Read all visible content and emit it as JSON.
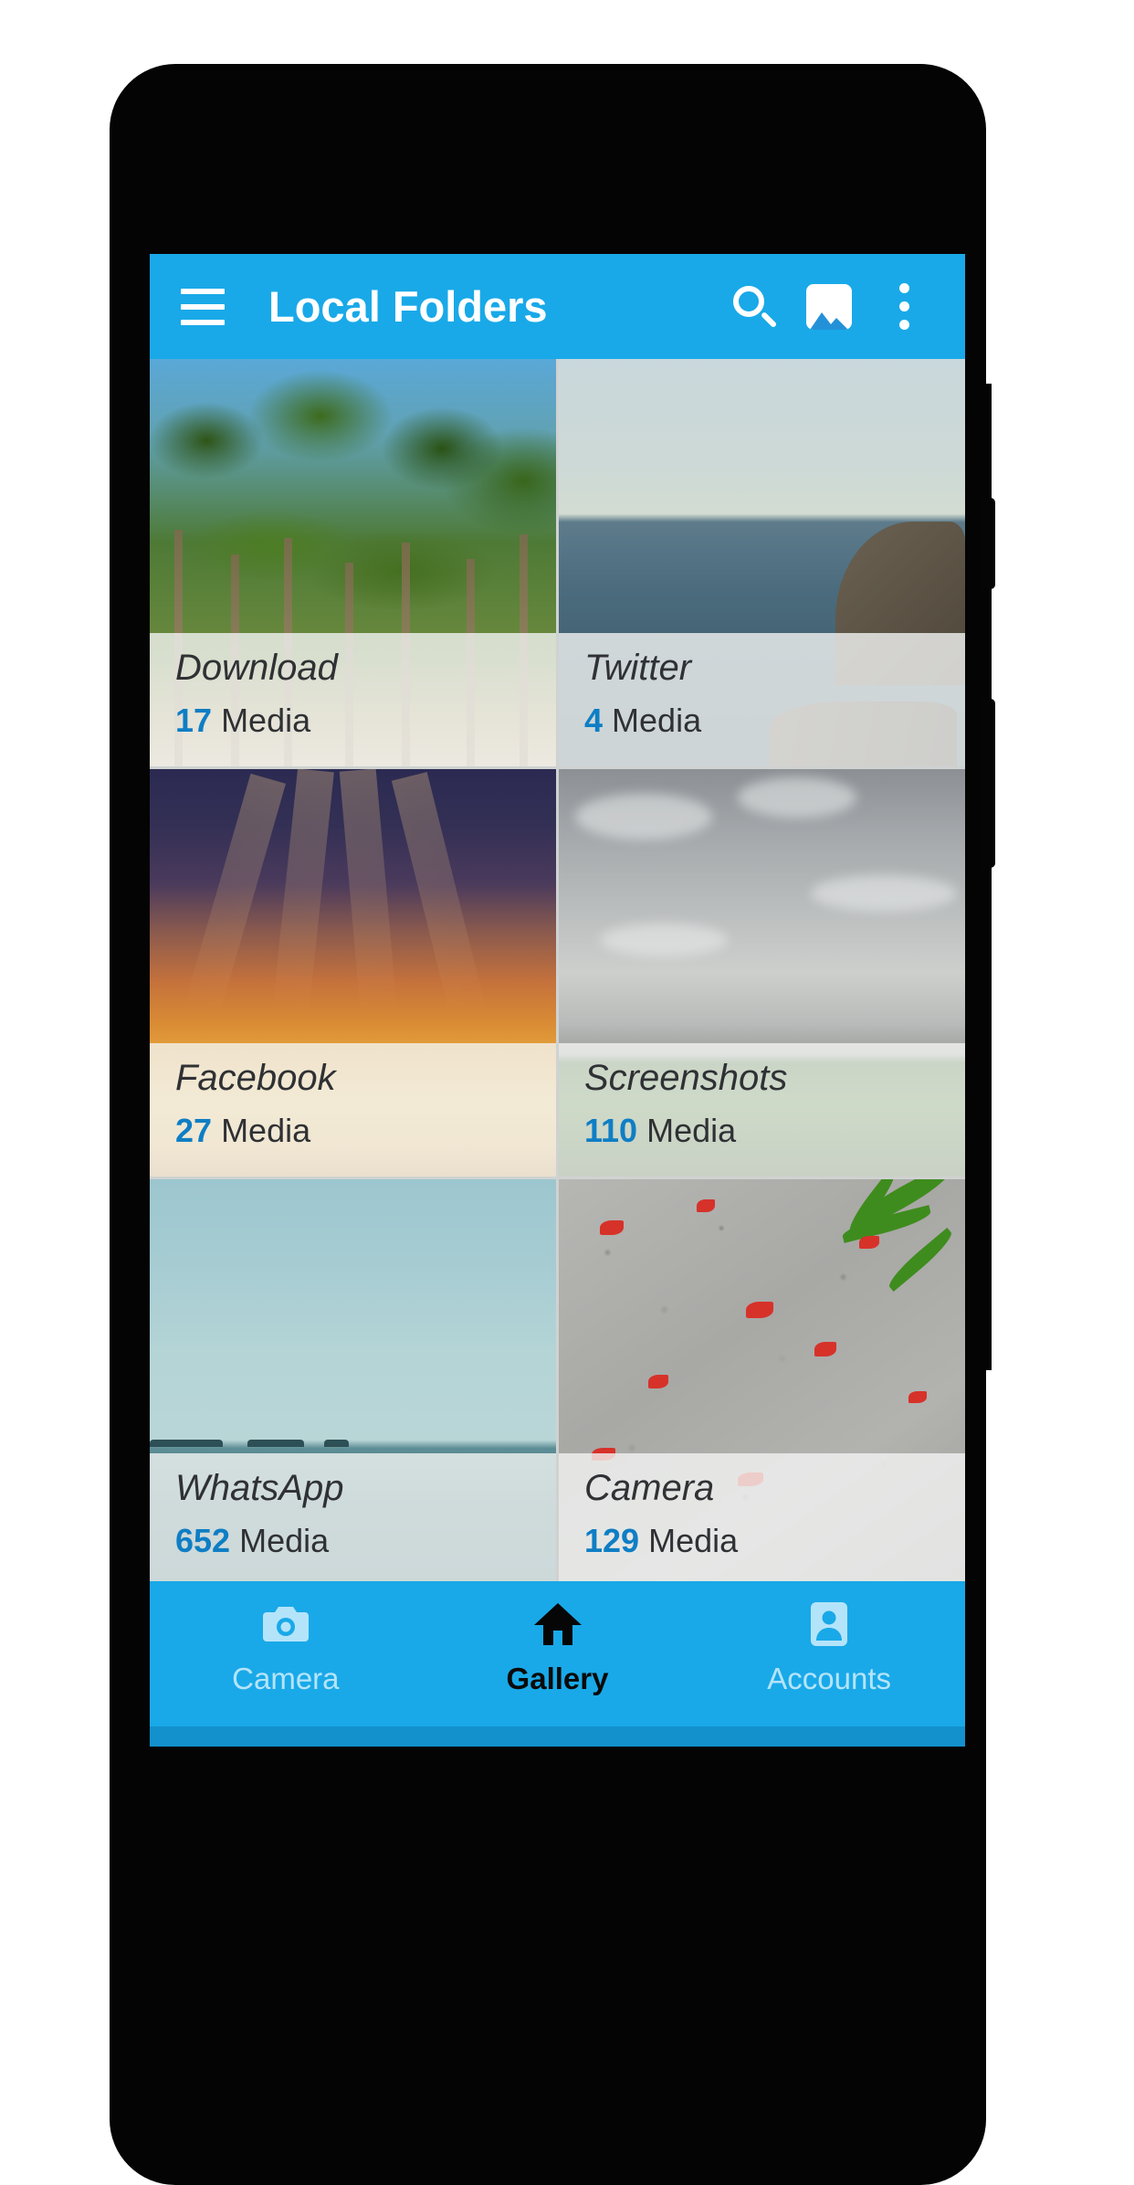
{
  "app": {
    "bar": {
      "title": "Local Folders",
      "menu_icon": "hamburger-menu-icon",
      "search_icon": "search-icon",
      "gallery_icon": "image-icon",
      "overflow_icon": "more-vertical-icon",
      "background_color": "#19a9e8",
      "text_color": "#ffffff"
    },
    "accent_color": "#0f7ec4",
    "count_unit": "Media"
  },
  "folders": [
    {
      "name": "Download",
      "count": "17",
      "unit": "Media",
      "thumb": "forest-trees-blue-sky"
    },
    {
      "name": "Twitter",
      "count": "4",
      "unit": "Media",
      "thumb": "rocky-coastline-ocean"
    },
    {
      "name": "Facebook",
      "count": "27",
      "unit": "Media",
      "thumb": "orange-sunset-clouds"
    },
    {
      "name": "Screenshots",
      "count": "110",
      "unit": "Media",
      "thumb": "grey-storm-clouds-treeline"
    },
    {
      "name": "WhatsApp",
      "count": "652",
      "unit": "Media",
      "thumb": "teal-sea-distant-islands"
    },
    {
      "name": "Camera",
      "count": "129",
      "unit": "Media",
      "thumb": "grey-gravel-red-petals"
    }
  ],
  "bottom_nav": {
    "background_color": "#19a9e8",
    "inactive_color": "#b4e4fa",
    "active_color": "#0a0a0a",
    "items": [
      {
        "label": "Camera",
        "icon": "camera-icon",
        "active": false
      },
      {
        "label": "Gallery",
        "icon": "home-icon",
        "active": true
      },
      {
        "label": "Accounts",
        "icon": "contact-icon",
        "active": false
      }
    ]
  },
  "device": {
    "frame_color": "#040404",
    "buttons": [
      {
        "name": "volume-button"
      },
      {
        "name": "power-button"
      }
    ]
  }
}
